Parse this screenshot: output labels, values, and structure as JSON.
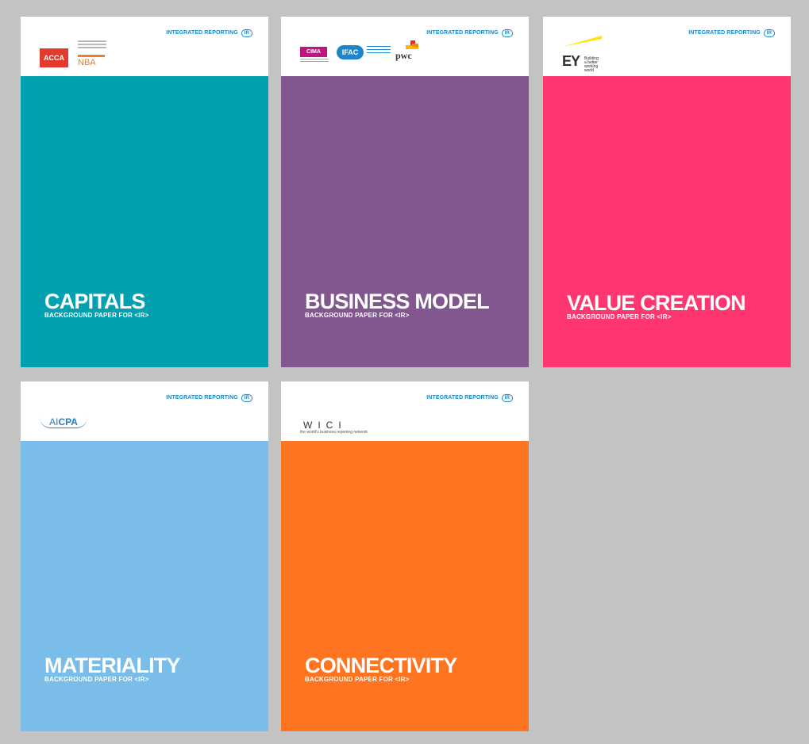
{
  "brand_label": "INTEGRATED REPORTING",
  "brand_mark": "IR",
  "covers": [
    {
      "title": "CAPITALS",
      "subtitle": "BACKGROUND PAPER FOR <IR>",
      "color": "#02a0b0",
      "logos": {
        "acca": "ACCA",
        "nba": "NBA"
      }
    },
    {
      "title": "BUSINESS MODEL",
      "subtitle": "BACKGROUND PAPER FOR <IR>",
      "color": "#82568f",
      "logos": {
        "cima": "CIMA",
        "ifac": "IFAC",
        "pwc": "pwc"
      }
    },
    {
      "title": "VALUE CREATION",
      "subtitle": "BACKGROUND PAPER FOR <IR>",
      "color": "#ff3670",
      "logos": {
        "ey": "EY",
        "ey_tagline_1": "Building a better",
        "ey_tagline_2": "working world"
      }
    },
    {
      "title": "MATERIALITY",
      "subtitle": "BACKGROUND PAPER FOR <IR>",
      "color": "#7abde8",
      "logos": {
        "aicpa_prefix": "AI",
        "aicpa_suffix": "CPA"
      }
    },
    {
      "title": "CONNECTIVITY",
      "subtitle": "BACKGROUND PAPER FOR <IR>",
      "color": "#ff7420",
      "logos": {
        "wici": "WICI",
        "wici_tagline": "the world's business reporting network"
      }
    }
  ]
}
